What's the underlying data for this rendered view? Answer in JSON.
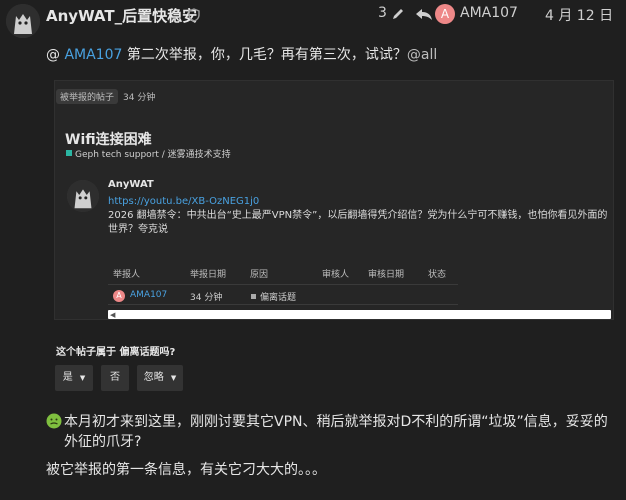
{
  "post": {
    "author": "AnyWAT_后置快稳安",
    "reply_count": "3",
    "reply_to_avatar_letter": "A",
    "reply_to_user": "AMA107",
    "date": "4 月 12 日",
    "mention_prefix": "@ ",
    "mention_user": "AMA107",
    "mention_text": " 第二次举报，你，几毛？再有第三次，试试？",
    "mention_all": "@all"
  },
  "flag": {
    "badge": "被举报的帖子",
    "time": "34 分钟",
    "topic_title": "Wifi连接困难",
    "category": "Geph tech support / 迷雾通技术支持",
    "category_color": "#2bb6a3",
    "inner_author": "AnyWAT",
    "link": "https://youtu.be/XB-OzNEG1j0",
    "body": "2026 翻墙禁令：中共出台“史上最严VPN禁令”，以后翻墙得凭介绍信？党为什么宁可不赚钱，也怕你看见外面的世界？夸克说",
    "table_headers": [
      "举报人",
      "举报日期",
      "原因",
      "审核人",
      "审核日期",
      "状态"
    ],
    "row": {
      "avatar_letter": "A",
      "user": "AMA107",
      "date": "34 分钟",
      "reason": "偏离话题"
    },
    "question": "这个帖子属于 偏离话题吗?",
    "buttons": {
      "yes": "是",
      "no": "否",
      "ignore": "忽略"
    }
  },
  "comment": {
    "line1": "本月初才来到这里，刚刚讨要其它VPN、稍后就举报对D不利的所谓“垃圾”信息，妥妥的外征的爪牙?",
    "line2": "被它举报的第一条信息，有关它刁大大的。。。"
  }
}
